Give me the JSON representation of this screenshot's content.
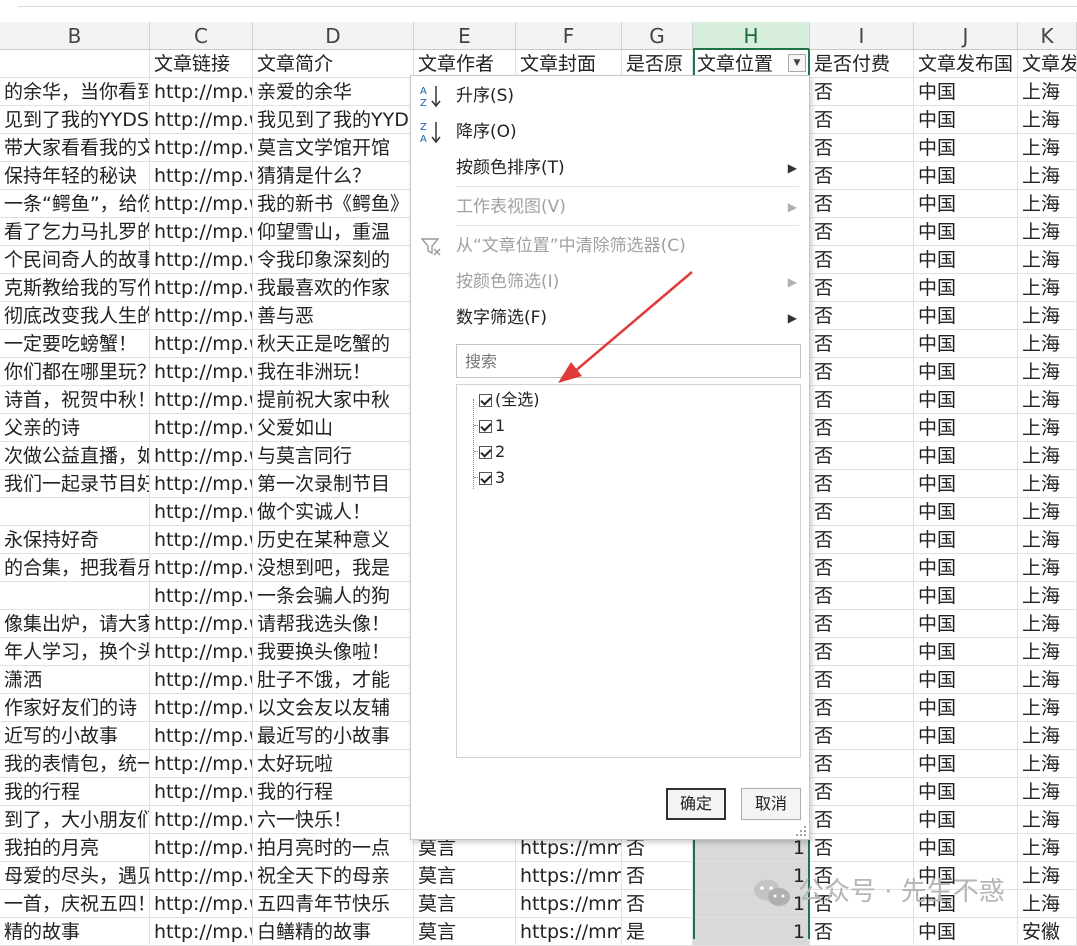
{
  "columns": [
    {
      "letter": "B",
      "header": ""
    },
    {
      "letter": "C",
      "header": "文章链接"
    },
    {
      "letter": "D",
      "header": "文章简介"
    },
    {
      "letter": "E",
      "header": "文章作者"
    },
    {
      "letter": "F",
      "header": "文章封面"
    },
    {
      "letter": "G",
      "header": "是否原"
    },
    {
      "letter": "H",
      "header": "文章位置"
    },
    {
      "letter": "I",
      "header": "是否付费"
    },
    {
      "letter": "J",
      "header": "文章发布国"
    },
    {
      "letter": "K",
      "header": "文章发"
    }
  ],
  "selected_column": "H",
  "rows": [
    {
      "B": "的余华，当你看到",
      "C": "http://mp.weixin",
      "D": "亲爱的余华",
      "I": "否",
      "J": "中国",
      "K": "上海"
    },
    {
      "B": "见到了我的YYDS",
      "C": "http://mp.weixin",
      "D": "我见到了我的YYDS",
      "I": "否",
      "J": "中国",
      "K": "上海"
    },
    {
      "B": "带大家看看我的文",
      "C": "http://mp.weixin",
      "D": "莫言文学馆开馆",
      "I": "否",
      "J": "中国",
      "K": "上海"
    },
    {
      "B": "保持年轻的秘诀",
      "C": "http://mp.weixin",
      "D": "猜猜是什么？",
      "I": "否",
      "J": "中国",
      "K": "上海"
    },
    {
      "B": "一条“鳄鱼”，给你",
      "C": "http://mp.weixin",
      "D": "我的新书《鳄鱼》",
      "I": "否",
      "J": "中国",
      "K": "上海"
    },
    {
      "B": "看了乞力马扎罗的",
      "C": "http://mp.weixin",
      "D": "仰望雪山，重温",
      "I": "否",
      "J": "中国",
      "K": "上海"
    },
    {
      "B": "个民间奇人的故事",
      "C": "http://mp.weixin",
      "D": "令我印象深刻的",
      "I": "否",
      "J": "中国",
      "K": "上海"
    },
    {
      "B": "克斯教给我的写作",
      "C": "http://mp.weixin",
      "D": "我最喜欢的作家",
      "I": "否",
      "J": "中国",
      "K": "上海"
    },
    {
      "B": "彻底改变我人生的一",
      "C": "http://mp.weixin",
      "D": "善与恶",
      "I": "否",
      "J": "中国",
      "K": "上海"
    },
    {
      "B": "一定要吃螃蟹！",
      "C": "http://mp.weixin",
      "D": "秋天正是吃蟹的",
      "I": "否",
      "J": "中国",
      "K": "上海"
    },
    {
      "B": "你们都在哪里玩？",
      "C": "http://mp.weixin",
      "D": "我在非洲玩！",
      "I": "否",
      "J": "中国",
      "K": "上海"
    },
    {
      "B": "诗首，祝贺中秋！",
      "C": "http://mp.weixin",
      "D": "提前祝大家中秋",
      "I": "否",
      "J": "中国",
      "K": "上海"
    },
    {
      "B": "父亲的诗",
      "C": "http://mp.weixin",
      "D": "父爱如山",
      "I": "否",
      "J": "中国",
      "K": "上海"
    },
    {
      "B": "次做公益直播，如",
      "C": "http://mp.weixin",
      "D": "与莫言同行",
      "I": "否",
      "J": "中国",
      "K": "上海"
    },
    {
      "B": "我们一起录节目好",
      "C": "http://mp.weixin",
      "D": "第一次录制节目",
      "I": "否",
      "J": "中国",
      "K": "上海"
    },
    {
      "B": "",
      "C": "http://mp.weixin",
      "D": "做个实诚人！",
      "I": "否",
      "J": "中国",
      "K": "上海"
    },
    {
      "B": "永保持好奇",
      "C": "http://mp.weixin",
      "D": "历史在某种意义",
      "I": "否",
      "J": "中国",
      "K": "上海"
    },
    {
      "B": "的合集，把我看乐",
      "C": "http://mp.weixin",
      "D": "没想到吧，我是",
      "I": "否",
      "J": "中国",
      "K": "上海"
    },
    {
      "B": "",
      "C": "http://mp.weixin",
      "D": "一条会骗人的狗",
      "I": "否",
      "J": "中国",
      "K": "上海"
    },
    {
      "B": "像集出炉，请大家",
      "C": "http://mp.weixin",
      "D": "请帮我选头像！",
      "I": "否",
      "J": "中国",
      "K": "上海"
    },
    {
      "B": "年人学习，换个头",
      "C": "http://mp.weixin",
      "D": "我要换头像啦！",
      "I": "否",
      "J": "中国",
      "K": "上海"
    },
    {
      "B": "潇洒",
      "C": "http://mp.weixin",
      "D": "肚子不饿，才能",
      "I": "否",
      "J": "中国",
      "K": "上海"
    },
    {
      "B": "作家好友们的诗",
      "C": "http://mp.weixin",
      "D": "以文会友以友辅",
      "I": "否",
      "J": "中国",
      "K": "上海"
    },
    {
      "B": "近写的小故事",
      "C": "http://mp.weixin",
      "D": "最近写的小故事",
      "I": "否",
      "J": "中国",
      "K": "上海"
    },
    {
      "B": "我的表情包，统一",
      "C": "http://mp.weixin",
      "D": "太好玩啦",
      "I": "否",
      "J": "中国",
      "K": "上海"
    },
    {
      "B": "我的行程",
      "C": "http://mp.weixin",
      "D": "我的行程",
      "I": "否",
      "J": "中国",
      "K": "上海"
    },
    {
      "B": "到了，大小朋友们",
      "C": "http://mp.weixin",
      "D": "六一快乐！",
      "I": "否",
      "J": "中国",
      "K": "上海"
    },
    {
      "B": "我拍的月亮",
      "C": "http://mp.weixin",
      "D": "拍月亮时的一点",
      "E": "莫言",
      "F": "https://mmbiz",
      "G": "否",
      "H": "1",
      "I": "否",
      "J": "中国",
      "K": "上海"
    },
    {
      "B": "母爱的尽头，遇见",
      "C": "http://mp.weixin",
      "D": "祝全天下的母亲",
      "E": "莫言",
      "F": "https://mmbiz",
      "G": "否",
      "H": "1",
      "I": "否",
      "J": "中国",
      "K": "上海"
    },
    {
      "B": "一首，庆祝五四！",
      "C": "http://mp.weixin",
      "D": "五四青年节快乐",
      "E": "莫言",
      "F": "https://mmbiz",
      "G": "否",
      "H": "1",
      "I": "否",
      "J": "中国",
      "K": "上海"
    },
    {
      "B": "精的故事",
      "C": "http://mp.weixin",
      "D": "白鳝精的故事",
      "E": "莫言",
      "F": "https://mmbiz",
      "G": "是",
      "H": "1",
      "I": "否",
      "J": "中国",
      "K": "安徽"
    }
  ],
  "filter_menu": {
    "items": [
      {
        "label": "升序(S)",
        "icon": "sort-ascending-icon",
        "enabled": true,
        "submenu": false
      },
      {
        "label": "降序(O)",
        "icon": "sort-descending-icon",
        "enabled": true,
        "submenu": false
      },
      {
        "label": "按颜色排序(T)",
        "enabled": true,
        "submenu": true
      },
      {
        "label": "工作表视图(V)",
        "enabled": false,
        "submenu": true
      },
      {
        "label": "从“文章位置”中清除筛选器(C)",
        "icon": "clear-filter-icon",
        "enabled": false,
        "submenu": false
      },
      {
        "label": "按颜色筛选(I)",
        "enabled": false,
        "submenu": true
      },
      {
        "label": "数字筛选(F)",
        "enabled": true,
        "submenu": true
      }
    ],
    "search_placeholder": "搜索",
    "values": [
      {
        "label": "(全选)",
        "checked": true
      },
      {
        "label": "1",
        "checked": true
      },
      {
        "label": "2",
        "checked": true
      },
      {
        "label": "3",
        "checked": true
      }
    ],
    "ok_label": "确定",
    "cancel_label": "取消"
  },
  "watermark": "公众号 · 先生不惑",
  "colors": {
    "selected_header": "#d8eedd",
    "selected_border": "#217346",
    "filtered_cell": "#d9d9d9",
    "arrow": "#e03a3a"
  }
}
